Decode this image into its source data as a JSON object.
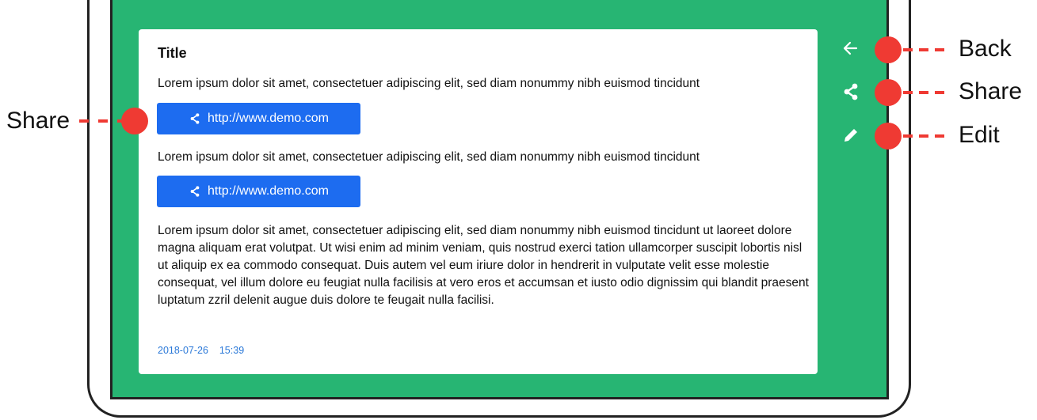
{
  "card": {
    "title": "Title",
    "paragraph_1": "Lorem ipsum dolor sit amet, consectetuer adipiscing elit, sed diam nonummy nibh euismod tincidunt",
    "paragraph_2": "Lorem ipsum dolor sit amet, consectetuer adipiscing elit, sed diam nonummy nibh euismod tincidunt",
    "paragraph_3": "Lorem ipsum dolor sit amet, consectetuer adipiscing elit, sed diam nonummy nibh euismod tincidunt ut laoreet dolore magna aliquam erat volutpat. Ut wisi enim ad minim veniam, quis nostrud exerci tation ullamcorper suscipit lobortis nisl ut aliquip ex ea commodo consequat. Duis autem vel eum iriure dolor in hendrerit in vulputate velit esse molestie consequat, vel illum dolore eu feugiat nulla facilisis at vero eros et accumsan et iusto odio dignissim qui blandit praesent luptatum zzril delenit augue duis dolore te feugait nulla facilisi.",
    "link_button_1": "http://www.demo.com",
    "link_button_2": "http://www.demo.com",
    "date": "2018-07-26",
    "time": "15:39"
  },
  "side_actions": [
    {
      "icon": "arrow-left-icon"
    },
    {
      "icon": "share-icon"
    },
    {
      "icon": "pencil-icon"
    }
  ],
  "callouts": {
    "left_share": "Share",
    "back": "Back",
    "share": "Share",
    "edit": "Edit"
  },
  "colors": {
    "screen": "#27b573",
    "button": "#1d6cf0",
    "annotation": "#ef3a33",
    "timestamp": "#2a78d8"
  }
}
